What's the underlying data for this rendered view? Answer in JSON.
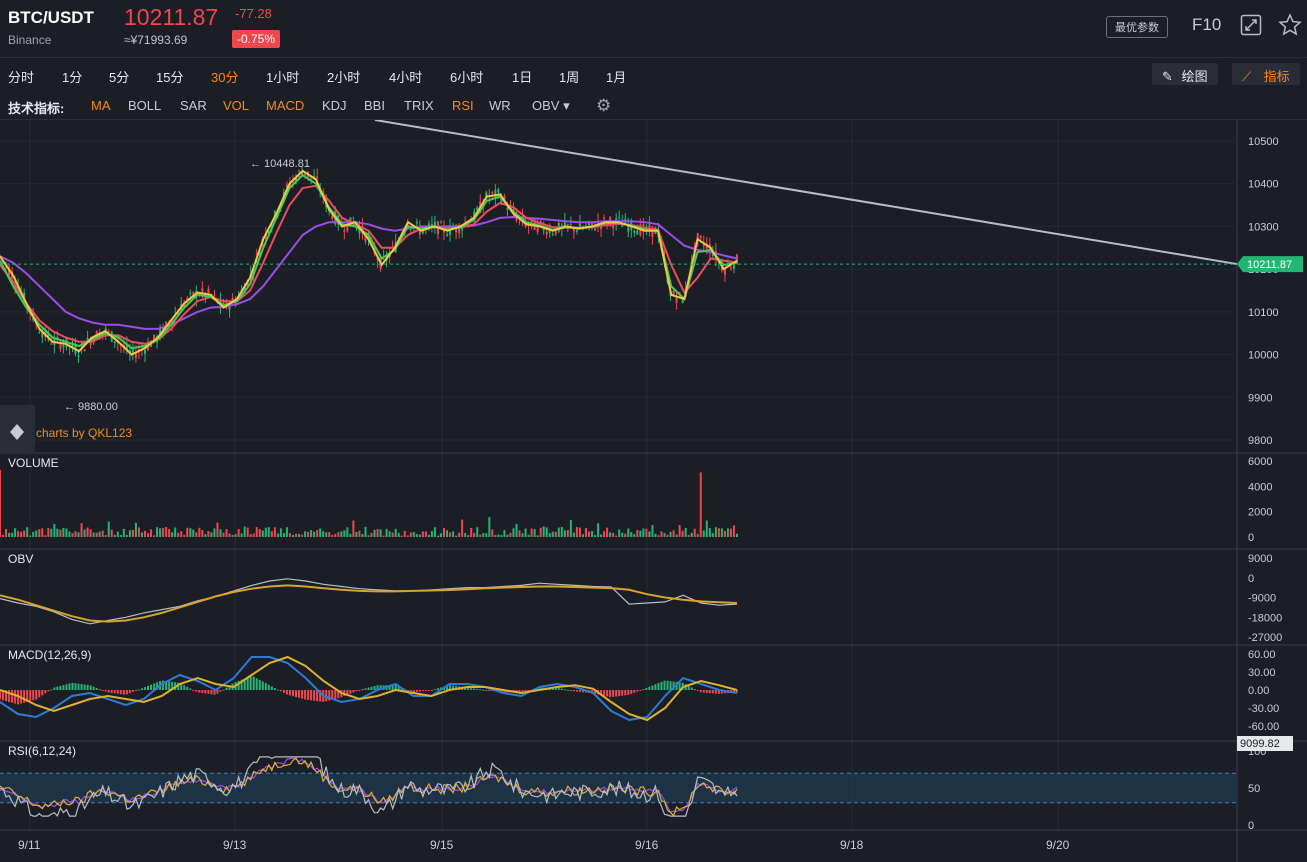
{
  "header": {
    "symbol": "BTC/USDT",
    "exchange": "Binance",
    "price": "10211.87",
    "change": "-77.28",
    "cny_price": "≈¥71993.69",
    "change_pct": "-0.75%",
    "best_params_label": "最优参数",
    "f10_label": "F10",
    "icons": [
      "fullscreen-icon",
      "star-icon"
    ]
  },
  "timeframes": [
    {
      "label": "分时",
      "active": false
    },
    {
      "label": "1分",
      "active": false
    },
    {
      "label": "5分",
      "active": false
    },
    {
      "label": "15分",
      "active": false
    },
    {
      "label": "30分",
      "active": true
    },
    {
      "label": "1小时",
      "active": false
    },
    {
      "label": "2小时",
      "active": false
    },
    {
      "label": "4小时",
      "active": false
    },
    {
      "label": "6小时",
      "active": false
    },
    {
      "label": "1日",
      "active": false
    },
    {
      "label": "1周",
      "active": false
    },
    {
      "label": "1月",
      "active": false
    }
  ],
  "toolbar_right": {
    "draw_label": "绘图",
    "indicator_label": "指标"
  },
  "indicator_bar": {
    "label": "技术指标:",
    "items": [
      {
        "label": "MA",
        "active": true
      },
      {
        "label": "BOLL",
        "active": false
      },
      {
        "label": "SAR",
        "active": false
      },
      {
        "label": "VOL",
        "active": true
      },
      {
        "label": "MACD",
        "active": true
      },
      {
        "label": "KDJ",
        "active": false
      },
      {
        "label": "BBI",
        "active": false
      },
      {
        "label": "TRIX",
        "active": false
      },
      {
        "label": "RSI",
        "active": true
      },
      {
        "label": "WR",
        "active": false
      },
      {
        "label": "OBV",
        "active": false,
        "dropdown": true
      }
    ]
  },
  "colors": {
    "background": "#1c1e26",
    "up": "#22b573",
    "down": "#f0464e",
    "accent": "#f08a24",
    "ma_yellow": "#f2c744",
    "ma_green": "#3ecf5a",
    "ma_red": "#ef4b5c",
    "ma_purple": "#9a4ee6",
    "trendline": "#b8bcc4",
    "obv": "#b8bcc4",
    "obv_ma": "#d8a32a",
    "macd_dif": "#2b7bd6",
    "macd_dea": "#e0b030"
  },
  "chart_data": [
    {
      "type": "candlestick",
      "panel": "price",
      "watermark": "charts by QKL123",
      "yticks": [
        "10500",
        "10400",
        "10300",
        "10200",
        "10100",
        "10000",
        "9900",
        "9800"
      ],
      "ylim": [
        9800,
        10500
      ],
      "xticks": [
        "9/11",
        "9/13",
        "9/15",
        "9/16",
        "9/18",
        "9/20"
      ],
      "current_price_label": "10211.87",
      "current_price": 10211.87,
      "high_annotation": {
        "text": "← 10448.81",
        "value": 10448.81
      },
      "low_annotation": {
        "text": "← 9880.00",
        "value": 9880.0
      },
      "ma_series": [
        {
          "color": "yellow",
          "values": [
            10230,
            10185,
            10120,
            10060,
            10030,
            10025,
            10008,
            10040,
            10055,
            10030,
            10000,
            10015,
            10040,
            10080,
            10120,
            10145,
            10140,
            10110,
            10130,
            10180,
            10270,
            10330,
            10400,
            10430,
            10410,
            10340,
            10300,
            10310,
            10270,
            10210,
            10250,
            10310,
            10290,
            10300,
            10290,
            10300,
            10320,
            10370,
            10375,
            10330,
            10305,
            10300,
            10290,
            10300,
            10295,
            10300,
            10310,
            10310,
            10300,
            10290,
            10290,
            10140,
            10130,
            10270,
            10250,
            10200,
            10220
          ]
        },
        {
          "color": "green",
          "values": [
            10220,
            10160,
            10110,
            10070,
            10040,
            10030,
            10020,
            10035,
            10050,
            10040,
            10015,
            10020,
            10035,
            10070,
            10110,
            10140,
            10135,
            10115,
            10125,
            10165,
            10250,
            10320,
            10390,
            10420,
            10400,
            10345,
            10305,
            10300,
            10280,
            10225,
            10245,
            10300,
            10295,
            10300,
            10292,
            10298,
            10315,
            10360,
            10370,
            10335,
            10310,
            10302,
            10292,
            10298,
            10296,
            10299,
            10308,
            10308,
            10302,
            10293,
            10290,
            10160,
            10130,
            10240,
            10245,
            10210,
            10215
          ]
        },
        {
          "color": "red",
          "values": [
            10210,
            10170,
            10120,
            10080,
            10055,
            10040,
            10030,
            10030,
            10045,
            10045,
            10030,
            10025,
            10035,
            10060,
            10095,
            10125,
            10135,
            10125,
            10125,
            10150,
            10215,
            10285,
            10350,
            10390,
            10395,
            10360,
            10320,
            10305,
            10290,
            10250,
            10250,
            10280,
            10295,
            10298,
            10296,
            10297,
            10305,
            10335,
            10355,
            10345,
            10320,
            10308,
            10298,
            10297,
            10297,
            10298,
            10303,
            10306,
            10303,
            10296,
            10292,
            10210,
            10145,
            10180,
            10225,
            10220,
            10215
          ]
        },
        {
          "color": "purple",
          "values": [
            10230,
            10215,
            10190,
            10160,
            10130,
            10100,
            10085,
            10075,
            10070,
            10070,
            10065,
            10060,
            10060,
            10070,
            10085,
            10100,
            10110,
            10112,
            10118,
            10130,
            10160,
            10200,
            10240,
            10280,
            10300,
            10310,
            10310,
            10310,
            10305,
            10295,
            10290,
            10295,
            10300,
            10300,
            10300,
            10300,
            10302,
            10310,
            10320,
            10322,
            10320,
            10318,
            10315,
            10312,
            10310,
            10310,
            10312,
            10312,
            10312,
            10310,
            10305,
            10280,
            10255,
            10245,
            10240,
            10232,
            10225
          ]
        }
      ]
    },
    {
      "type": "bar",
      "panel": "volume",
      "title": "VOLUME",
      "yticks": [
        "6000",
        "4000",
        "2000",
        "0"
      ],
      "ylim": [
        0,
        6000
      ],
      "spikes": [
        {
          "index": 0,
          "value": 5300,
          "color": "down"
        },
        {
          "index": 232,
          "value": 5100,
          "color": "down"
        },
        {
          "index": 246,
          "value": 2500,
          "color": "up"
        }
      ]
    },
    {
      "type": "line",
      "panel": "obv",
      "title": "OBV",
      "yticks": [
        "9000",
        "0",
        "-9000",
        "-18000",
        "-27000"
      ],
      "ylim": [
        -27000,
        9000
      ],
      "series": [
        {
          "color": "obv",
          "values": [
            -9500,
            -11500,
            -13000,
            -15500,
            -19000,
            -21000,
            -19500,
            -18000,
            -16000,
            -14500,
            -13000,
            -10500,
            -8500,
            -6000,
            -3500,
            -1500,
            -500,
            -1500,
            -3000,
            -4000,
            -5000,
            -5500,
            -6000,
            -6000,
            -5500,
            -5000,
            -4500,
            -4500,
            -4000,
            -3500,
            -2500,
            -3000,
            -3500,
            -4000,
            -4200,
            -12000,
            -11500,
            -11000,
            -8000,
            -11500,
            -12500,
            -12000
          ]
        },
        {
          "color": "obv_ma",
          "values": [
            -8000,
            -10000,
            -12500,
            -15000,
            -17500,
            -19500,
            -20000,
            -19500,
            -18000,
            -16000,
            -13500,
            -11000,
            -8500,
            -6500,
            -5000,
            -4000,
            -3500,
            -4000,
            -4800,
            -5500,
            -6000,
            -6200,
            -6200,
            -6000,
            -5800,
            -5600,
            -5200,
            -4800,
            -4500,
            -4200,
            -4000,
            -4000,
            -4200,
            -4500,
            -4700,
            -5500,
            -7500,
            -9000,
            -10000,
            -10800,
            -11200,
            -11500
          ]
        }
      ]
    },
    {
      "type": "line",
      "panel": "macd",
      "title": "MACD(12,26,9)",
      "yticks": [
        "60.00",
        "30.00",
        "0.00",
        "-30.00",
        "-60.00"
      ],
      "ylim": [
        -60,
        60
      ],
      "series": [
        {
          "name": "DIF",
          "color": "macd_dif",
          "values": [
            -20,
            -40,
            -45,
            -30,
            -10,
            -5,
            -15,
            -25,
            -15,
            10,
            25,
            15,
            0,
            20,
            55,
            55,
            45,
            20,
            -10,
            -20,
            -15,
            0,
            10,
            -10,
            -10,
            10,
            10,
            5,
            -5,
            -10,
            5,
            10,
            5,
            -5,
            -35,
            -50,
            -45,
            -10,
            20,
            10,
            0,
            -5
          ]
        },
        {
          "name": "DEA",
          "color": "macd_dea",
          "values": [
            0,
            -10,
            -25,
            -35,
            -25,
            -15,
            -10,
            -15,
            -20,
            -10,
            10,
            20,
            10,
            5,
            25,
            45,
            55,
            40,
            15,
            -5,
            -15,
            -10,
            0,
            -5,
            -10,
            0,
            5,
            5,
            0,
            -5,
            0,
            5,
            8,
            2,
            -20,
            -40,
            -50,
            -30,
            5,
            15,
            8,
            0
          ]
        }
      ]
    },
    {
      "type": "line",
      "panel": "rsi",
      "title": "RSI(6,12,24)",
      "yticks": [
        "100",
        "50",
        "0"
      ],
      "ylim": [
        0,
        100
      ],
      "band": [
        30,
        70
      ],
      "cursor_label": "9099.82"
    }
  ]
}
